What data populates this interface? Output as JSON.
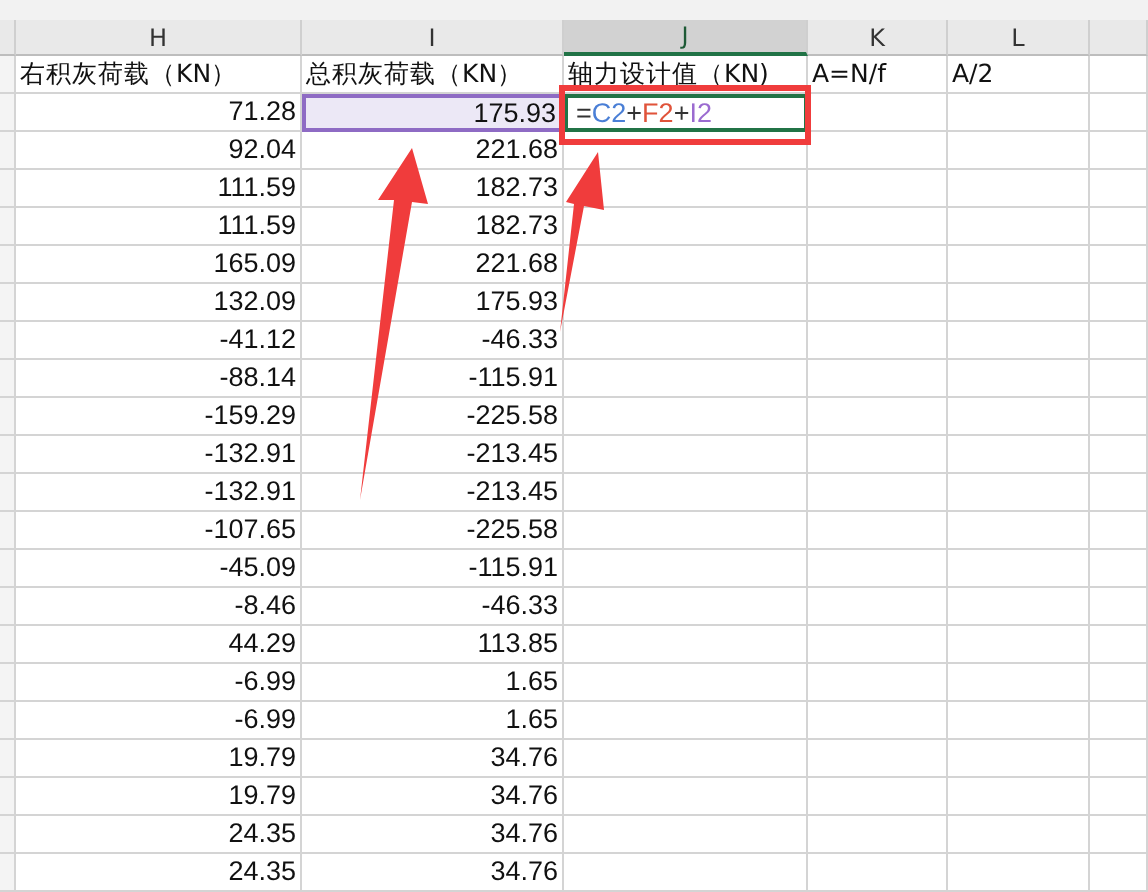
{
  "columns": [
    {
      "label": "H",
      "selected": false
    },
    {
      "label": "I",
      "selected": false
    },
    {
      "label": "J",
      "selected": true
    },
    {
      "label": "K",
      "selected": false
    },
    {
      "label": "L",
      "selected": false
    }
  ],
  "header_row": [
    "右积灰荷载（KN）",
    "总积灰荷载（KN）",
    "轴力设计值（KN)",
    "A=N/f",
    "A/2"
  ],
  "formula": [
    {
      "text": "=",
      "color": "#333333"
    },
    {
      "text": "C2",
      "color": "#4a7fd6"
    },
    {
      "text": "+",
      "color": "#333333"
    },
    {
      "text": "F2",
      "color": "#e0533a"
    },
    {
      "text": "+",
      "color": "#333333"
    },
    {
      "text": "I2",
      "color": "#9b6bd0"
    }
  ],
  "rows": [
    {
      "h": "71.28",
      "i": "175.93",
      "i_referenced": true
    },
    {
      "h": "92.04",
      "i": "221.68",
      "i_referenced": false
    },
    {
      "h": "111.59",
      "i": "182.73",
      "i_referenced": false
    },
    {
      "h": "111.59",
      "i": "182.73",
      "i_referenced": false
    },
    {
      "h": "165.09",
      "i": "221.68",
      "i_referenced": false
    },
    {
      "h": "132.09",
      "i": "175.93",
      "i_referenced": false
    },
    {
      "h": "-41.12",
      "i": "-46.33",
      "i_referenced": false
    },
    {
      "h": "-88.14",
      "i": "-115.91",
      "i_referenced": false
    },
    {
      "h": "-159.29",
      "i": "-225.58",
      "i_referenced": false
    },
    {
      "h": "-132.91",
      "i": "-213.45",
      "i_referenced": false
    },
    {
      "h": "-132.91",
      "i": "-213.45",
      "i_referenced": false
    },
    {
      "h": "-107.65",
      "i": "-225.58",
      "i_referenced": false
    },
    {
      "h": "-45.09",
      "i": "-115.91",
      "i_referenced": false
    },
    {
      "h": "-8.46",
      "i": "-46.33",
      "i_referenced": false
    },
    {
      "h": "44.29",
      "i": "113.85",
      "i_referenced": false
    },
    {
      "h": "-6.99",
      "i": "1.65",
      "i_referenced": false
    },
    {
      "h": "-6.99",
      "i": "1.65",
      "i_referenced": false
    },
    {
      "h": "19.79",
      "i": "34.76",
      "i_referenced": false
    },
    {
      "h": "19.79",
      "i": "34.76",
      "i_referenced": false
    },
    {
      "h": "24.35",
      "i": "34.76",
      "i_referenced": false
    },
    {
      "h": "24.35",
      "i": "34.76",
      "i_referenced": false
    }
  ]
}
